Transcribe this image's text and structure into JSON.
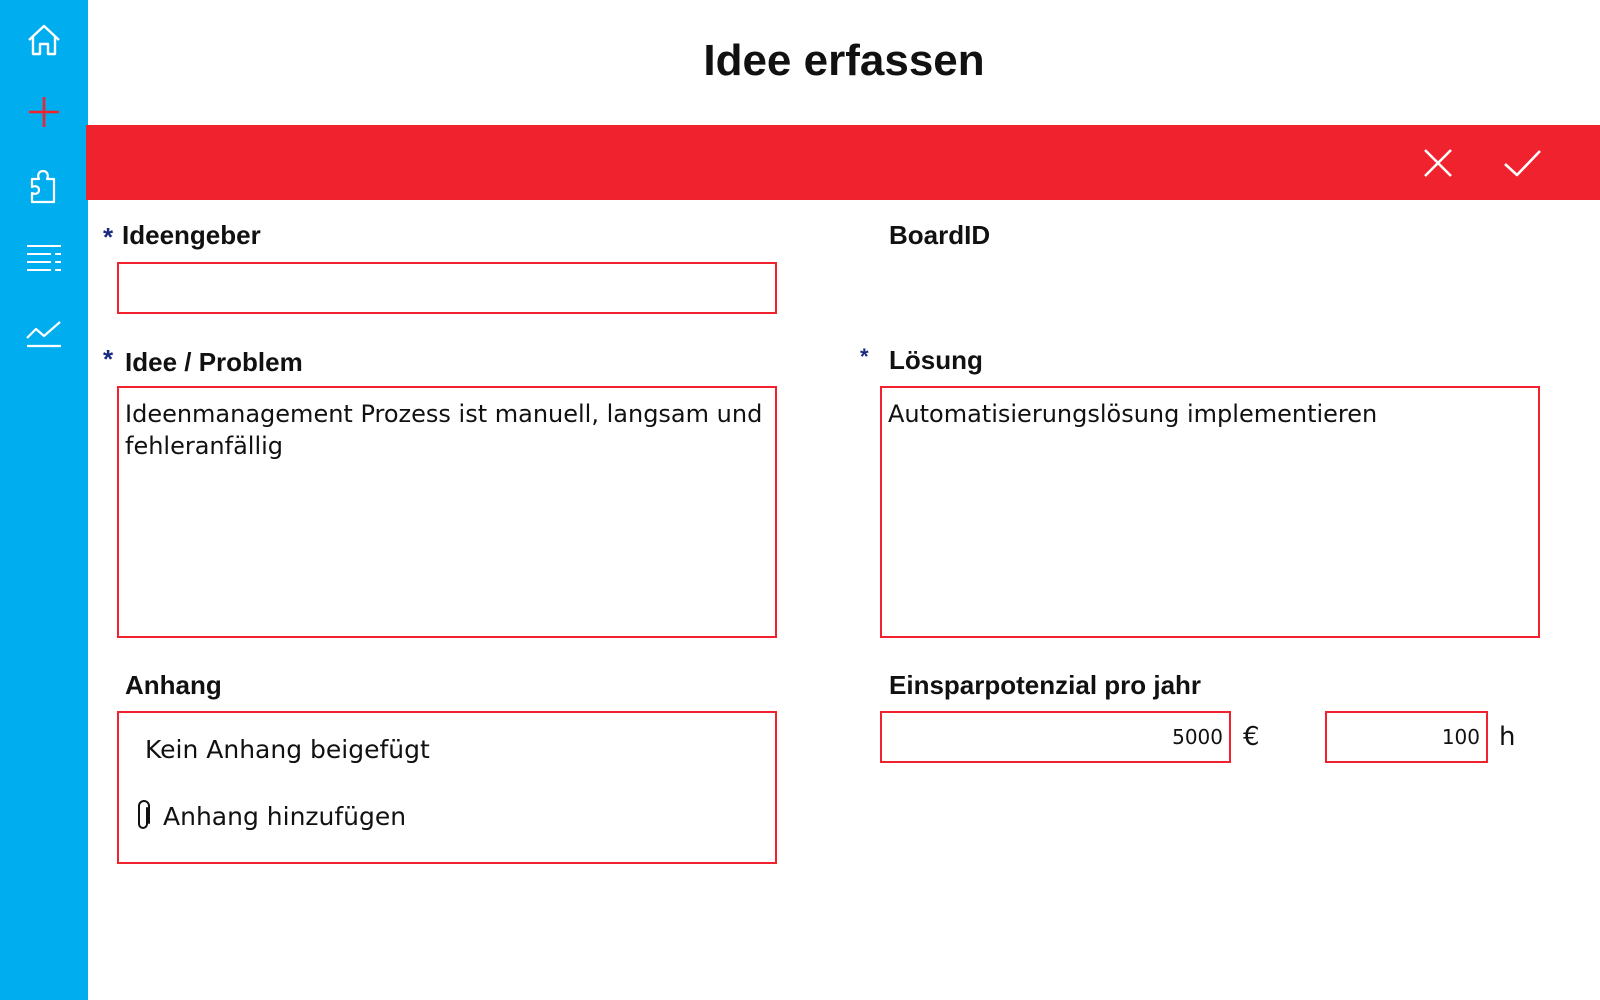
{
  "page": {
    "title": "Idee erfassen"
  },
  "sidebar": {
    "items": [
      {
        "icon": "home-icon"
      },
      {
        "icon": "plus-icon"
      },
      {
        "icon": "puzzle-icon"
      },
      {
        "icon": "list-icon"
      },
      {
        "icon": "trend-chart-icon"
      }
    ]
  },
  "toolbar": {
    "cancel_icon": "close-icon",
    "confirm_icon": "check-icon"
  },
  "colors": {
    "sidebar": "#00aeef",
    "accent": "#ef222e",
    "required_marker": "#1a2a80"
  },
  "form": {
    "required_marker": "*",
    "ideengeber": {
      "label": "Ideengeber",
      "value": ""
    },
    "board_id": {
      "label": "BoardID"
    },
    "idee_problem": {
      "label": "Idee / Problem",
      "value": "Ideenmanagement Prozess ist manuell, langsam und fehleranfällig"
    },
    "loesung": {
      "label": "Lösung",
      "value": "Automatisierungslösung implementieren"
    },
    "anhang": {
      "label": "Anhang",
      "empty_text": "Kein Anhang beigefügt",
      "add_label": "Anhang hinzufügen"
    },
    "einsparpotenzial": {
      "label": "Einsparpotenzial pro jahr",
      "euro_value": "5000",
      "euro_unit": "€",
      "hours_value": "100",
      "hours_unit": "h"
    }
  }
}
